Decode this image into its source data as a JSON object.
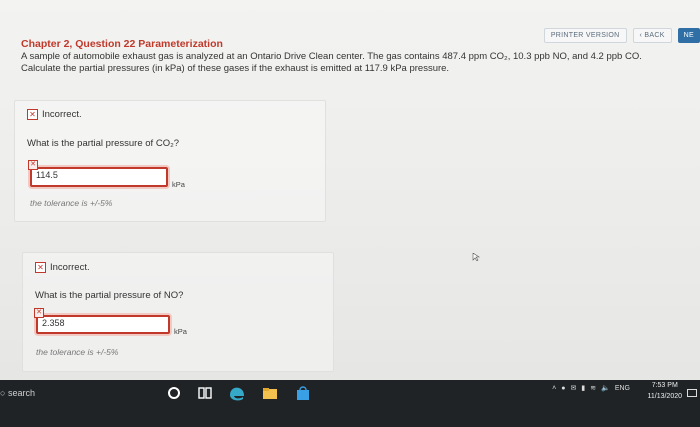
{
  "nav": {
    "printer_version": "PRINTER VERSION",
    "back": "BACK",
    "next": "NE"
  },
  "question": {
    "title": "Chapter 2, Question 22 Parameterization",
    "text_line1": "A sample of automobile exhaust gas is analyzed at an Ontario Drive Clean center. The gas contains 487.4 ppm CO₂, 10.3 ppb NO, and 4.2 ppb CO.",
    "text_line2": "Calculate the partial pressures (in kPa) of these gases if the exhaust is emitted at 117.9 kPa pressure."
  },
  "parts": [
    {
      "status": "Incorrect.",
      "prompt": "What is the partial pressure of CO₂?",
      "answer": "114.5",
      "unit": "kPa",
      "tolerance": "the tolerance is +/-5%"
    },
    {
      "status": "Incorrect.",
      "prompt": "What is the partial pressure of NO?",
      "answer": "2.358",
      "unit": "kPa",
      "tolerance": "the tolerance is +/-5%"
    }
  ],
  "taskbar": {
    "search": "search",
    "language": "ENG",
    "time": "7:53 PM",
    "date": "11/13/2020"
  },
  "colors": {
    "error": "#c0392b",
    "taskbar": "#1f2326",
    "next_button": "#2f6fa5"
  }
}
